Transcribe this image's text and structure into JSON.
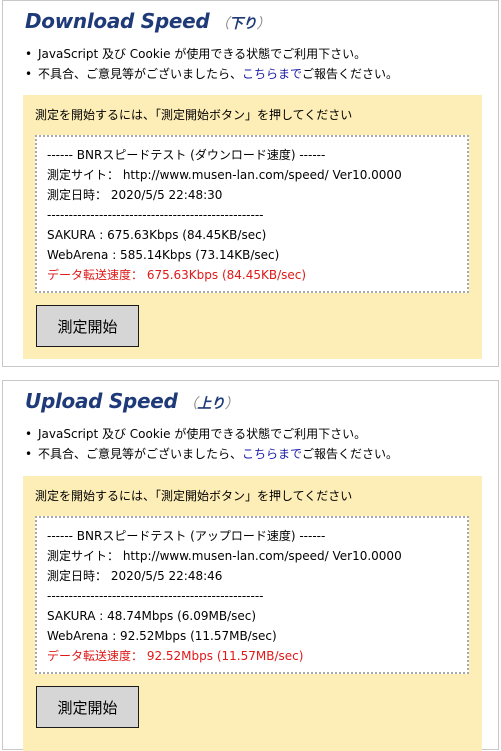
{
  "download": {
    "title": "Download Speed",
    "subtitle": "下り",
    "notes": {
      "note1": "JavaScript 及び Cookie が使用できる状態でご利用下さい。",
      "note2_prefix": "不具合、ご意見等がございましたら、",
      "note2_link": "こちらまで",
      "note2_suffix": "ご報告ください。"
    },
    "instruction": "測定を開始するには、「測定開始ボタン」を押してください",
    "result": {
      "header": "------ BNRスピードテスト (ダウンロード速度) ------",
      "site": "測定サイト： http://www.musen-lan.com/speed/ Ver10.0000",
      "datetime": "測定日時： 2020/5/5 22:48:30",
      "separator": "--------------------------------------------------",
      "sakura": "SAKURA : 675.63Kbps (84.45KB/sec)",
      "webarena": "WebArena : 585.14Kbps (73.14KB/sec)",
      "transfer": "データ転送速度： 675.63Kbps (84.45KB/sec)"
    },
    "button_label": "測定開始"
  },
  "upload": {
    "title": "Upload Speed",
    "subtitle": "上り",
    "notes": {
      "note1": "JavaScript 及び Cookie が使用できる状態でご利用下さい。",
      "note2_prefix": "不具合、ご意見等がございましたら、",
      "note2_link": "こちらまで",
      "note2_suffix": "ご報告ください。"
    },
    "instruction": "測定を開始するには、「測定開始ボタン」を押してください",
    "result": {
      "header": "------ BNRスピードテスト (アップロード速度) ------",
      "site": "測定サイト： http://www.musen-lan.com/speed/ Ver10.0000",
      "datetime": "測定日時： 2020/5/5 22:48:46",
      "separator": "--------------------------------------------------",
      "sakura": "SAKURA : 48.74Mbps (6.09MB/sec)",
      "webarena": "WebArena : 92.52Mbps (11.57MB/sec)",
      "transfer": "データ転送速度： 92.52Mbps (11.57MB/sec)"
    },
    "button_label": "測定開始"
  },
  "colors": {
    "title": "#1f3a78",
    "panel_bg": "#fdedb6",
    "link": "#1a1aa6",
    "highlight": "#e01818",
    "button_bg": "#d6d6d6"
  }
}
